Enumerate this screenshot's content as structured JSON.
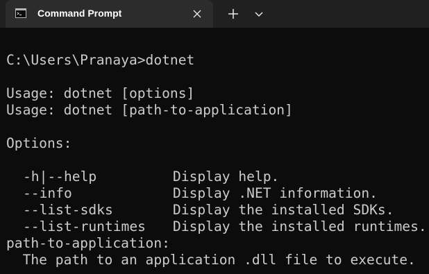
{
  "window": {
    "tab_title": "Command Prompt",
    "icons": {
      "tab": "cmd-icon",
      "close": "close-icon",
      "new_tab": "plus-icon",
      "dropdown": "chevron-down-icon"
    },
    "colors": {
      "background": "#0c0c0c",
      "titlebar": "#202020",
      "active_tab": "#2c2c2c",
      "text": "#cccccc"
    }
  },
  "terminal": {
    "prompt_line": "C:\\Users\\Pranaya>dotnet",
    "usage_lines": [
      "Usage: dotnet [options]",
      "Usage: dotnet [path-to-application]"
    ],
    "options_header": "Options:",
    "options": [
      {
        "flag": "-h|--help",
        "description": "Display help."
      },
      {
        "flag": "--info",
        "description": "Display .NET information."
      },
      {
        "flag": "--list-sdks",
        "description": "Display the installed SDKs."
      },
      {
        "flag": "--list-runtimes",
        "description": "Display the installed runtimes."
      }
    ],
    "path_header": "path-to-application:",
    "path_description": "  The path to an application .dll file to execute."
  }
}
